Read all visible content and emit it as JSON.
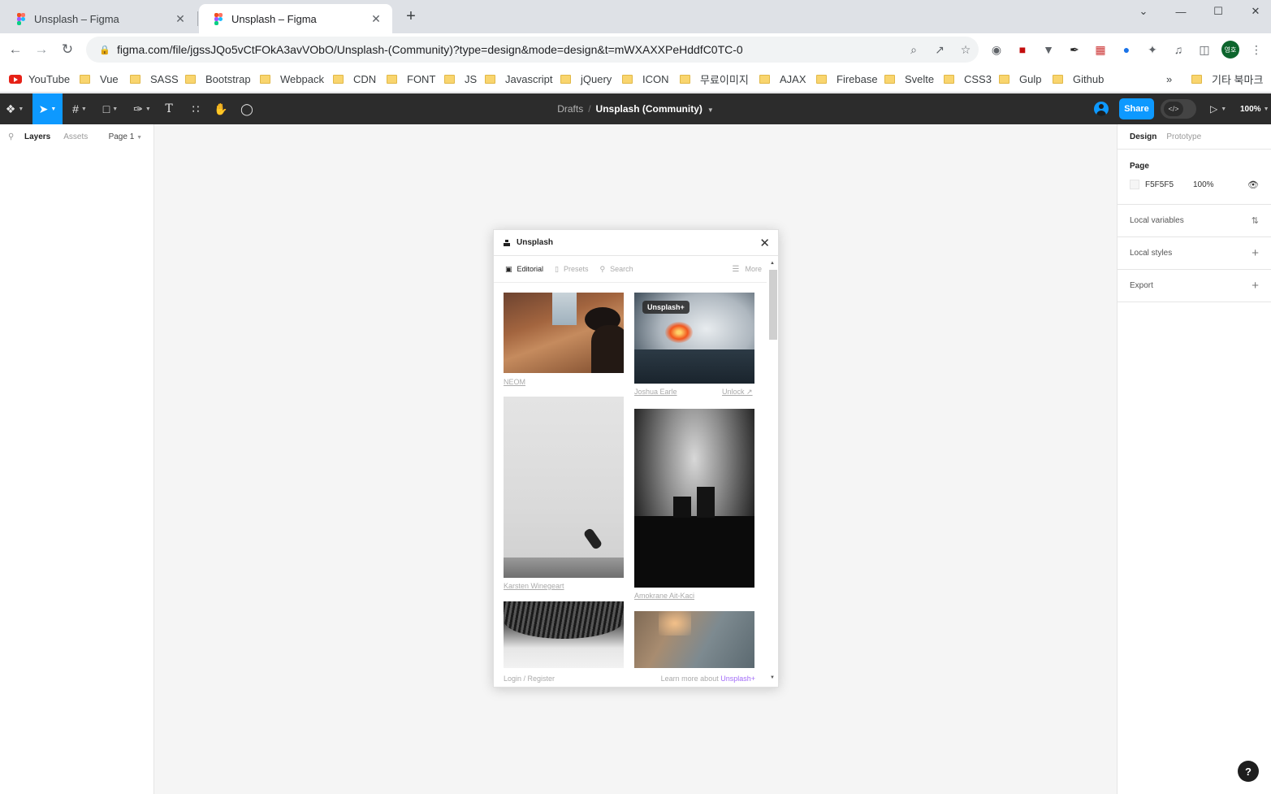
{
  "browser": {
    "tabs": [
      {
        "title": "Unsplash – Figma",
        "close": "✕"
      },
      {
        "title": "Unsplash – Figma",
        "close": "✕"
      }
    ],
    "new_tab": "+",
    "window": {
      "chevron": "⌄",
      "minimize": "—",
      "maximize": "☐",
      "close": "✕"
    },
    "nav": {
      "back": "←",
      "forward": "→",
      "reload": "↻"
    },
    "url": "figma.com/file/jgssJQo5vCtFOkA3avVObO/Unsplash-(Community)?type=design&mode=design&t=mWXAXXPeHddfC0TC-0",
    "profile_initials": "영호",
    "bookmarks": [
      "YouTube",
      "Vue",
      "SASS",
      "Bootstrap",
      "Webpack",
      "CDN",
      "FONT",
      "JS",
      "Javascript",
      "jQuery",
      "ICON",
      "무료이미지",
      "AJAX",
      "Firebase",
      "Svelte",
      "CSS3",
      "Gulp",
      "Github"
    ],
    "bookmarks_overflow": "»",
    "other_bookmarks": "기타 북마크"
  },
  "figma": {
    "breadcrumb": {
      "parent": "Drafts",
      "separator": "/",
      "file": "Unsplash (Community)"
    },
    "share_label": "Share",
    "dev_mode_icon": "</>",
    "zoom": "100%",
    "left_panel": {
      "tabs": [
        "Layers",
        "Assets"
      ],
      "page_selector": "Page 1"
    },
    "right_panel": {
      "tabs": [
        "Design",
        "Prototype"
      ],
      "page_section": "Page",
      "page_color_hex": "F5F5F5",
      "page_opacity": "100%",
      "local_variables": "Local variables",
      "local_styles": "Local styles",
      "export": "Export"
    },
    "help": "?"
  },
  "plugin": {
    "title": "Unsplash",
    "tabs": [
      "Editorial",
      "Presets",
      "Search"
    ],
    "more": "More",
    "photos": [
      {
        "author": "NEOM"
      },
      {
        "author": "Joshua Earle",
        "badge": "Unsplash+",
        "action": "Unlock ↗"
      },
      {
        "author": "Karsten Winegeart"
      },
      {
        "author": "Amokrane Ait-Kaci"
      }
    ],
    "footer": {
      "login": "Login / Register",
      "learn_prefix": "Learn more about",
      "learn_link": "Unsplash+"
    }
  },
  "colors": {
    "figma_accent": "#0d99ff",
    "canvas": "#f5f5f5",
    "unsplash_plus": "#a26cf8"
  }
}
